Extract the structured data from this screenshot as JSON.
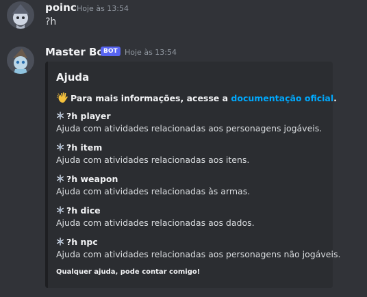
{
  "messages": [
    {
      "username": "poinc",
      "timestamp": "Hoje às 13:54",
      "text": "?h"
    },
    {
      "username": "Master Bot",
      "bot_tag": "BOT",
      "timestamp": "Hoje às 13:54",
      "embed": {
        "title": "Ajuda",
        "description_prefix": "Para mais informações, acesse a ",
        "description_link": "documentação oficial",
        "description_suffix": ".",
        "fields": [
          {
            "name": "?h player",
            "value": "Ajuda com atividades relacionadas aos personagens jogáveis."
          },
          {
            "name": "?h item",
            "value": "Ajuda com atividades relacionadas aos itens."
          },
          {
            "name": "?h weapon",
            "value": "Ajuda com atividades relacionadas às armas."
          },
          {
            "name": "?h dice",
            "value": "Ajuda com atividades relacionadas aos dados."
          },
          {
            "name": "?h npc",
            "value": "Ajuda com atividades relacionadas aos personagens não jogáveis."
          }
        ],
        "footer": "Qualquer ajuda, pode contar comigo!"
      }
    }
  ],
  "colors": {
    "background": "#313338",
    "embed_background": "#2b2d31",
    "link": "#00a8fc",
    "bot_tag": "#5865f2"
  }
}
